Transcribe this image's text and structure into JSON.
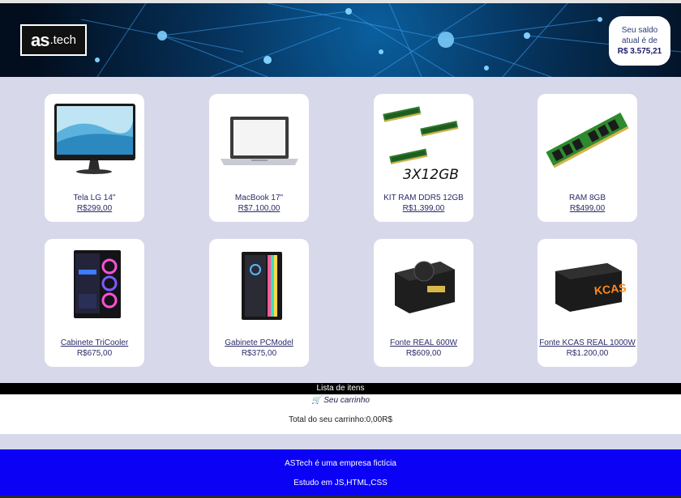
{
  "header": {
    "logo_as": "as",
    "logo_tech": ".tech",
    "balance_line1": "Seu saldo",
    "balance_line2": "atual é de",
    "balance_amount": "R$ 3.575,21"
  },
  "products": [
    {
      "name": "Tela LG 14\"",
      "price": "R$299,00",
      "icon": "monitor-icon"
    },
    {
      "name": "MacBook 17\"",
      "price": "R$7.100,00",
      "icon": "laptop-icon"
    },
    {
      "name": "KIT RAM DDR5 12GB",
      "price": "R$1.399,00",
      "icon": "ram-kit-icon",
      "image_text": "3X12GB"
    },
    {
      "name": "RAM 8GB",
      "price": "R$499,00",
      "icon": "ram-stick-icon"
    },
    {
      "name": "Cabinete TriCooler",
      "price": "R$675,00",
      "icon": "pc-case-icon"
    },
    {
      "name": "Gabinete PCModel",
      "price": "R$375,00",
      "icon": "pc-case-icon"
    },
    {
      "name": "Fonte REAL 600W",
      "price": "R$609,00",
      "icon": "power-supply-icon"
    },
    {
      "name": "Fonte KCAS REAL 1000W",
      "price": "R$1.200,00",
      "icon": "power-supply-icon",
      "image_text": "KCAS"
    }
  ],
  "cart": {
    "section_title": "Lista de itens",
    "cart_label": "Seu carrinho",
    "total_text": "Total do seu carrinho:0,00R$"
  },
  "footer": {
    "line1": "ASTech é uma empresa fictícia",
    "line2": "Estudo em JS,HTML,CSS"
  },
  "colors": {
    "background": "#d7d8ea",
    "footer": "#0a01f5",
    "card": "#ffffff",
    "text": "#2b2b6a"
  }
}
